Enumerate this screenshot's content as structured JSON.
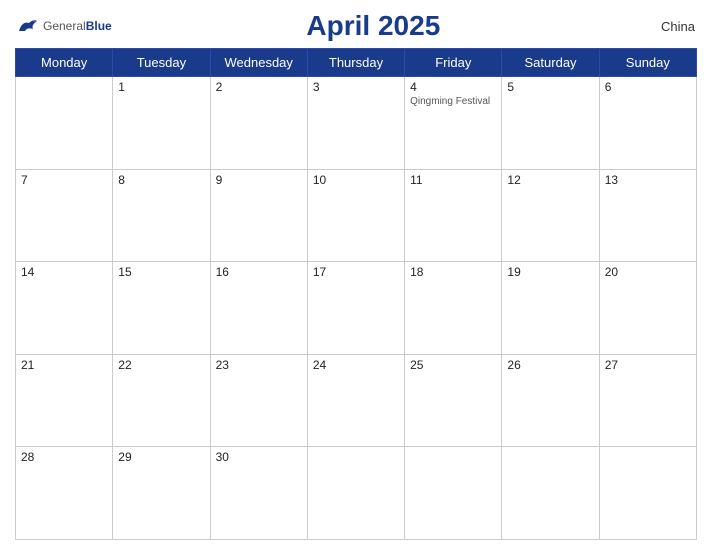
{
  "header": {
    "logo_general": "General",
    "logo_blue": "Blue",
    "title": "April 2025",
    "country": "China"
  },
  "weekdays": [
    "Monday",
    "Tuesday",
    "Wednesday",
    "Thursday",
    "Friday",
    "Saturday",
    "Sunday"
  ],
  "weeks": [
    [
      {
        "day": "",
        "empty": true
      },
      {
        "day": "1",
        "empty": false
      },
      {
        "day": "2",
        "empty": false
      },
      {
        "day": "3",
        "empty": false
      },
      {
        "day": "4",
        "empty": false,
        "event": "Qingming Festival"
      },
      {
        "day": "5",
        "empty": false
      },
      {
        "day": "6",
        "empty": false
      }
    ],
    [
      {
        "day": "7",
        "empty": false
      },
      {
        "day": "8",
        "empty": false
      },
      {
        "day": "9",
        "empty": false
      },
      {
        "day": "10",
        "empty": false
      },
      {
        "day": "11",
        "empty": false
      },
      {
        "day": "12",
        "empty": false
      },
      {
        "day": "13",
        "empty": false
      }
    ],
    [
      {
        "day": "14",
        "empty": false
      },
      {
        "day": "15",
        "empty": false
      },
      {
        "day": "16",
        "empty": false
      },
      {
        "day": "17",
        "empty": false
      },
      {
        "day": "18",
        "empty": false
      },
      {
        "day": "19",
        "empty": false
      },
      {
        "day": "20",
        "empty": false
      }
    ],
    [
      {
        "day": "21",
        "empty": false
      },
      {
        "day": "22",
        "empty": false
      },
      {
        "day": "23",
        "empty": false
      },
      {
        "day": "24",
        "empty": false
      },
      {
        "day": "25",
        "empty": false
      },
      {
        "day": "26",
        "empty": false
      },
      {
        "day": "27",
        "empty": false
      }
    ],
    [
      {
        "day": "28",
        "empty": false
      },
      {
        "day": "29",
        "empty": false
      },
      {
        "day": "30",
        "empty": false
      },
      {
        "day": "",
        "empty": true
      },
      {
        "day": "",
        "empty": true
      },
      {
        "day": "",
        "empty": true
      },
      {
        "day": "",
        "empty": true
      }
    ]
  ]
}
